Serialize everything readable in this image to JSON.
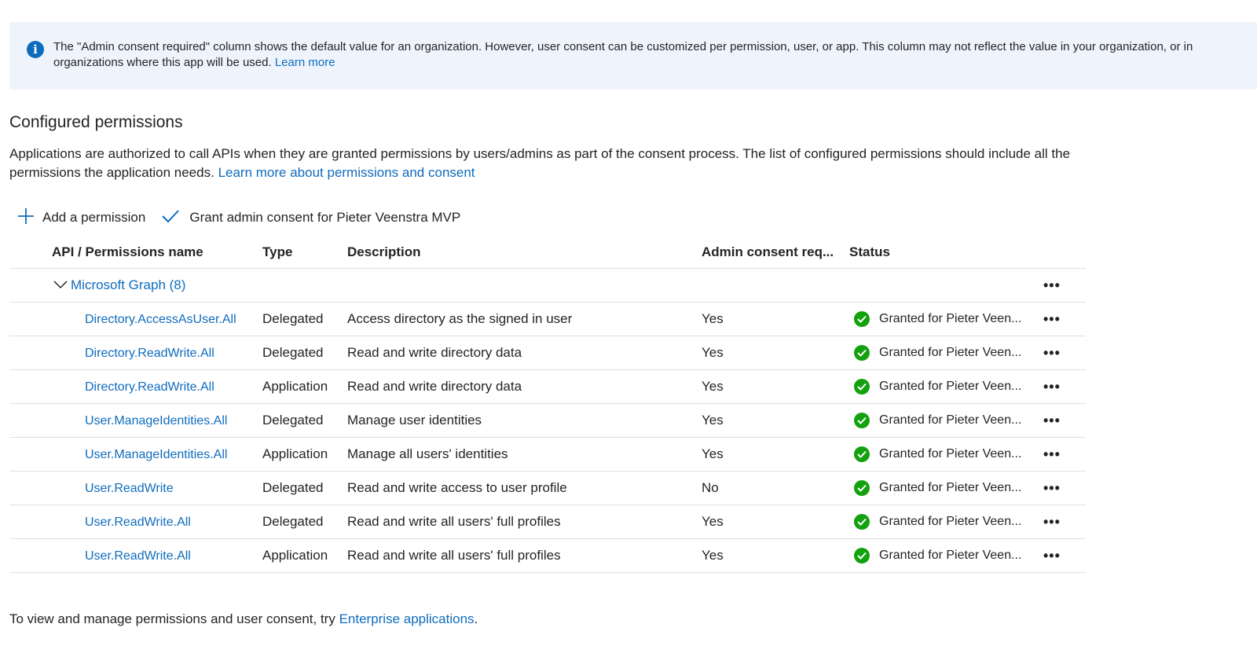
{
  "banner": {
    "text": "The \"Admin consent required\" column shows the default value for an organization. However, user consent can be customized per permission, user, or app. This column may not reflect the value in your organization, or in organizations where this app will be used.",
    "link": "Learn more",
    "icon": "info-icon"
  },
  "section": {
    "title": "Configured permissions",
    "desc": "Applications are authorized to call APIs when they are granted permissions by users/admins as part of the consent process. The list of configured permissions should include all the permissions the application needs.",
    "link": "Learn more about permissions and consent"
  },
  "toolbar": {
    "add_label": "Add a permission",
    "grant_label": "Grant admin consent for Pieter Veenstra MVP"
  },
  "table": {
    "headers": {
      "name": "API / Permissions name",
      "type": "Type",
      "description": "Description",
      "admin": "Admin consent req...",
      "status": "Status"
    },
    "group": {
      "label": "Microsoft Graph (8)",
      "more": "•••"
    },
    "rows": [
      {
        "name": "Directory.AccessAsUser.All",
        "type": "Delegated",
        "description": "Access directory as the signed in user",
        "admin": "Yes",
        "status": "Granted for Pieter Veen...",
        "more": "•••"
      },
      {
        "name": "Directory.ReadWrite.All",
        "type": "Delegated",
        "description": "Read and write directory data",
        "admin": "Yes",
        "status": "Granted for Pieter Veen...",
        "more": "•••"
      },
      {
        "name": "Directory.ReadWrite.All",
        "type": "Application",
        "description": "Read and write directory data",
        "admin": "Yes",
        "status": "Granted for Pieter Veen...",
        "more": "•••"
      },
      {
        "name": "User.ManageIdentities.All",
        "type": "Delegated",
        "description": "Manage user identities",
        "admin": "Yes",
        "status": "Granted for Pieter Veen...",
        "more": "•••"
      },
      {
        "name": "User.ManageIdentities.All",
        "type": "Application",
        "description": "Manage all users' identities",
        "admin": "Yes",
        "status": "Granted for Pieter Veen...",
        "more": "•••"
      },
      {
        "name": "User.ReadWrite",
        "type": "Delegated",
        "description": "Read and write access to user profile",
        "admin": "No",
        "status": "Granted for Pieter Veen...",
        "more": "•••"
      },
      {
        "name": "User.ReadWrite.All",
        "type": "Delegated",
        "description": "Read and write all users' full profiles",
        "admin": "Yes",
        "status": "Granted for Pieter Veen...",
        "more": "•••"
      },
      {
        "name": "User.ReadWrite.All",
        "type": "Application",
        "description": "Read and write all users' full profiles",
        "admin": "Yes",
        "status": "Granted for Pieter Veen...",
        "more": "•••"
      }
    ]
  },
  "footer": {
    "text": "To view and manage permissions and user consent, try",
    "link": "Enterprise applications",
    "suffix": "."
  },
  "colors": {
    "accent": "#0f6cbd",
    "success": "#13a10e",
    "banner_bg": "#eff4fc"
  }
}
